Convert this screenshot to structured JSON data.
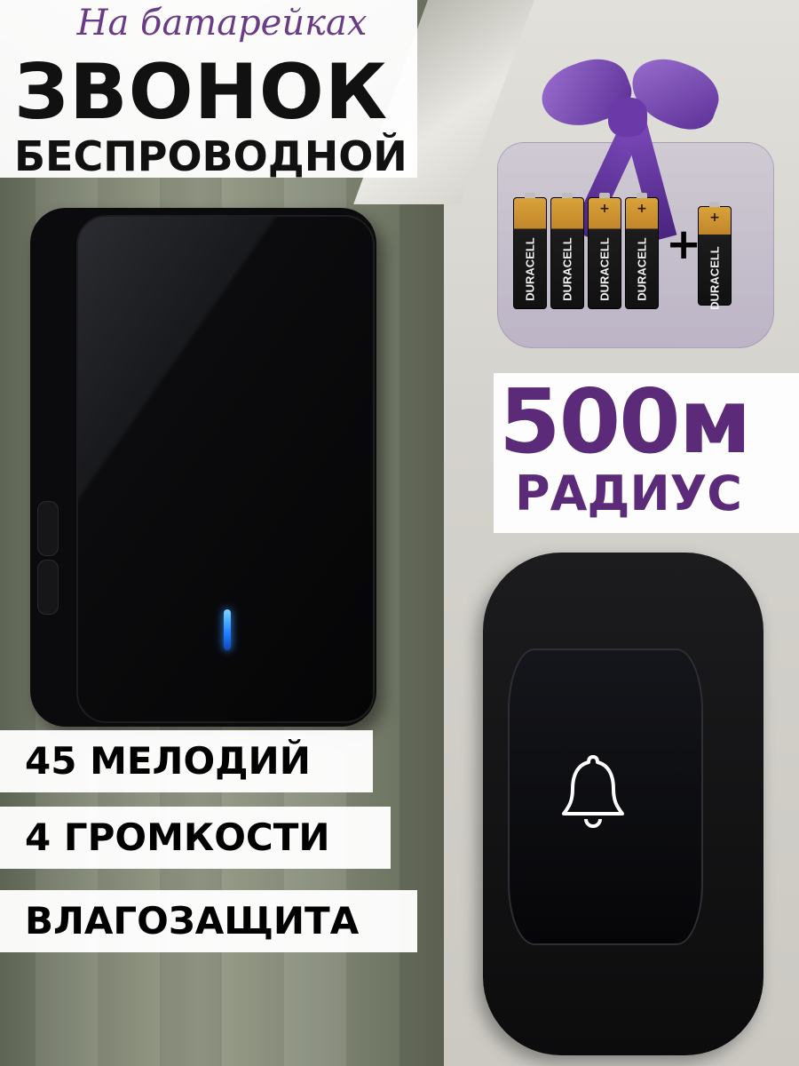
{
  "header": {
    "subtitle": "На батарейках",
    "title": "ЗВОНОК",
    "title_sub": "БЕСПРОВОДНОЙ"
  },
  "batteries": [
    {
      "label": "DURACELL",
      "mark": ""
    },
    {
      "label": "DURACELL",
      "mark": ""
    },
    {
      "label": "DURACELL",
      "mark": "+"
    },
    {
      "label": "DURACELL",
      "mark": "+"
    },
    {
      "label": "DURACELL",
      "mark": "+"
    }
  ],
  "plus_sign": "+",
  "range": {
    "value": "500м",
    "label": "РАДИУС"
  },
  "features": [
    "45 МЕЛОДИЙ",
    "4 ГРОМКОСТИ",
    "ВЛАГОЗАЩИТА"
  ],
  "icons": {
    "bell": "bell-icon",
    "led": "led-indicator"
  },
  "colors": {
    "accent": "#5b2a78",
    "subtitle": "#6b3c86",
    "led": "#1e7cff"
  }
}
